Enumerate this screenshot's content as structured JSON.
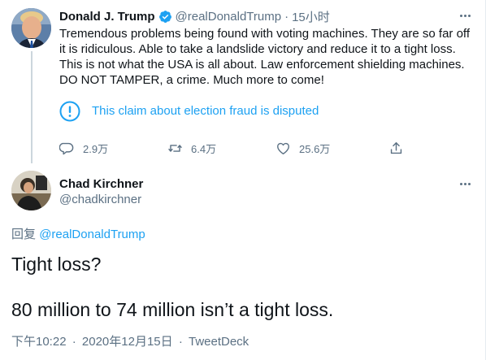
{
  "parent_tweet": {
    "display_name": "Donald J. Trump",
    "handle": "@realDonaldTrump",
    "time": "15小时",
    "text": "Tremendous problems being found with voting machines. They are so far off it is ridiculous. Able to take a landslide victory and reduce it to a tight loss. This is not what the USA is all about. Law enforcement shielding machines. DO NOT TAMPER, a crime. Much more to come!",
    "notice": "This claim about election fraud is disputed",
    "replies": "2.9万",
    "retweets": "6.4万",
    "likes": "25.6万"
  },
  "main_tweet": {
    "display_name": "Chad Kirchner",
    "handle": "@chadkirchner",
    "reply_prefix": "回复",
    "reply_mention": "@realDonaldTrump",
    "text": "Tight loss?\n\n80 million to 74 million isn’t a tight loss.",
    "time": "下午10:22",
    "date": "2020年12月15日",
    "source": "TweetDeck"
  },
  "icons": {
    "verified": "verified-badge-icon",
    "more": "more-options-icon",
    "notice": "exclamation-circle-icon",
    "reply": "comment-icon",
    "retweet": "retweet-icon",
    "like": "heart-icon",
    "share": "share-icon"
  },
  "colors": {
    "accent": "#1da1f2",
    "secondary_text": "#5b7083",
    "primary_text": "#0f1419",
    "thread_line": "#ccd6dd"
  }
}
